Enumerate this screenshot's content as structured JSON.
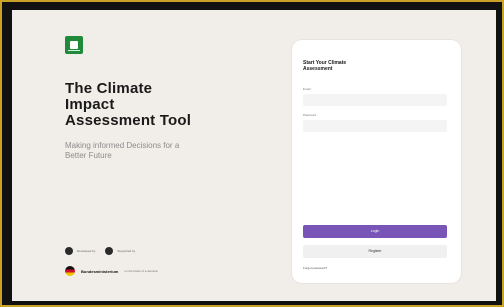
{
  "hero": {
    "title": "The Climate\nImpact\nAssessment Tool",
    "subtitle": "Making informed Decisions for a\nBetter Future"
  },
  "credits": [
    {
      "label": "Developed by"
    },
    {
      "label": "Supported by"
    }
  ],
  "partner": {
    "name": "Bundesministerium",
    "note": "on the basis of a decision"
  },
  "form": {
    "title": "Start Your Climate\nAssessment",
    "email_label": "Email",
    "email_value": "",
    "password_label": "Password",
    "password_value": "",
    "login_label": "Login",
    "register_label": "Register",
    "forgot_label": "Forgot password?"
  },
  "colors": {
    "background": "#f1ede8",
    "brand_green": "#1f8a3a",
    "primary_button": "#7a55b8",
    "frame_border": "#c9a227"
  },
  "icons": {
    "logo": "climate-tool-logo-icon",
    "credit_1": "developer-logo-icon",
    "credit_2": "supporter-logo-icon",
    "partner": "german-ministry-logo-icon"
  }
}
